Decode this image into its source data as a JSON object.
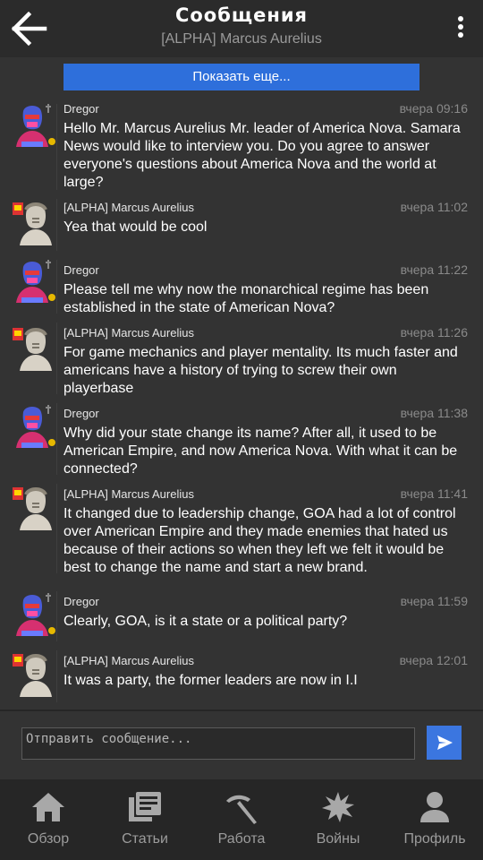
{
  "header": {
    "title": "Сообщения",
    "subtitle": "[ALPHA] Marcus Aurelius",
    "back_icon": "arrow-left-icon",
    "menu_icon": "more-vert-icon"
  },
  "show_more_label": "Показать еще...",
  "messages": [
    {
      "author": "Dregor",
      "time": "вчера 09:16",
      "text": "Hello Mr. Marcus Aurelius Mr. leader of America Nova. Samara News would like to interview you. Do you agree to answer everyone's questions about America Nova and the world at large?"
    },
    {
      "author": "[ALPHA] Marcus Aurelius",
      "time": "вчера 11:02",
      "text": "Yea that would be cool"
    },
    {
      "author": "Dregor",
      "time": "вчера 11:22",
      "text": "Please tell me why now the monarchical regime has been established in the state of American Nova?"
    },
    {
      "author": "[ALPHA] Marcus Aurelius",
      "time": "вчера 11:26",
      "text": "For game mechanics and player mentality. Its much faster and americans have a history of trying to screw their own playerbase"
    },
    {
      "author": "Dregor",
      "time": "вчера 11:38",
      "text": "Why did your state change its name? After all, it used to be American Empire, and now America Nova. With what it can be connected?"
    },
    {
      "author": "[ALPHA] Marcus Aurelius",
      "time": "вчера 11:41",
      "text": "It changed due to leadership change, GOA had a lot of control over American Empire and they made enemies that hated us because of their actions so when they left we felt it would be best to change the name and start a new brand."
    },
    {
      "author": "Dregor",
      "time": "вчера 11:59",
      "text": "Clearly, GOA, is it a state or a political party?"
    },
    {
      "author": "[ALPHA] Marcus Aurelius",
      "time": "вчера 12:01",
      "text": "It was a party, the former leaders are now in I.I"
    }
  ],
  "composer": {
    "placeholder": "Отправить сообщение...",
    "send_icon": "send-icon"
  },
  "tabs": [
    {
      "label": "Обзор",
      "icon": "home-icon"
    },
    {
      "label": "Статьи",
      "icon": "articles-icon"
    },
    {
      "label": "Работа",
      "icon": "pickaxe-icon"
    },
    {
      "label": "Войны",
      "icon": "explosion-icon"
    },
    {
      "label": "Профиль",
      "icon": "user-icon"
    }
  ],
  "colors": {
    "background": "#333333",
    "header": "#2b2b2b",
    "accent": "#2e6fdb",
    "tabbar": "#262626"
  }
}
